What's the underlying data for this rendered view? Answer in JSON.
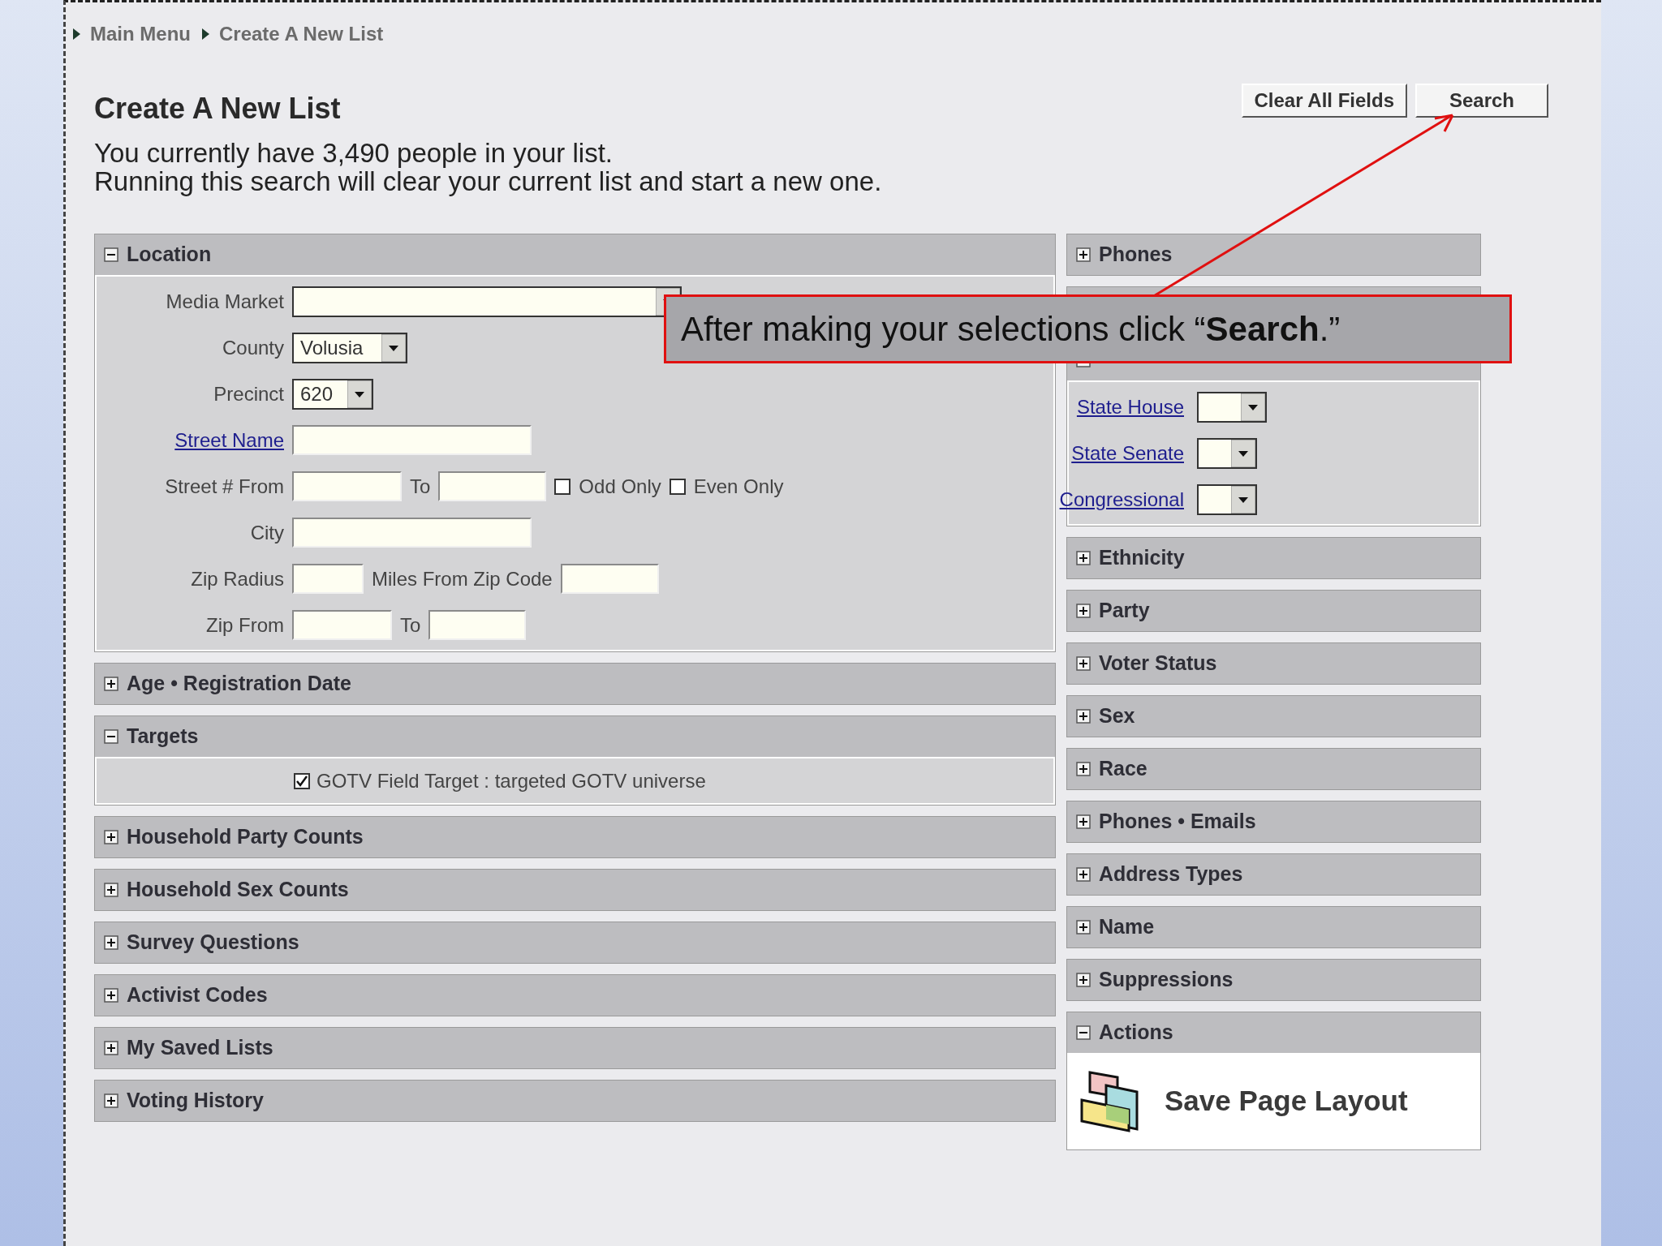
{
  "breadcrumb": [
    "Main Menu",
    "Create A New List"
  ],
  "title": "Create A New List",
  "intro": [
    "You currently have 3,490 people in your list.",
    "Running this search will clear your current list and start a new one."
  ],
  "buttons": [
    "Clear All Fields",
    "Search"
  ],
  "left_panels": [
    {
      "kind": "panel",
      "title": "Location",
      "expanded": true,
      "body": {
        "kind": "location",
        "media_market": {
          "label": "Media Market"
        },
        "county": {
          "label": "County",
          "value": "Volusia"
        },
        "precinct": {
          "label": "Precinct",
          "value": "620"
        },
        "street_name": {
          "label": "Street Name"
        },
        "street_from": {
          "label": "Street # From",
          "to_label": "To",
          "odd": {
            "label": "Odd Only",
            "checked": false
          },
          "even": {
            "label": "Even Only",
            "checked": false
          }
        },
        "city": {
          "label": "City"
        },
        "zip_radius": {
          "label": "Zip Radius",
          "miles_label": "Miles From Zip Code"
        },
        "zip_from": {
          "label": "Zip From",
          "to_label": "To"
        }
      }
    },
    {
      "kind": "panel",
      "title": "Age • Registration Date",
      "expanded": false
    },
    {
      "kind": "panel",
      "title": "Targets",
      "expanded": true,
      "body": {
        "kind": "targets",
        "items": [
          {
            "label": "GOTV Field Target : targeted GOTV universe",
            "checked": true
          }
        ]
      }
    },
    {
      "kind": "panel",
      "title": "Household Party Counts",
      "expanded": false
    },
    {
      "kind": "panel",
      "title": "Household Sex Counts",
      "expanded": false
    },
    {
      "kind": "panel",
      "title": "Survey Questions",
      "expanded": false
    },
    {
      "kind": "panel",
      "title": "Activist Codes",
      "expanded": false
    },
    {
      "kind": "panel",
      "title": "My Saved Lists",
      "expanded": false
    },
    {
      "kind": "panel",
      "title": "Voting History",
      "expanded": false
    }
  ],
  "right_panels": [
    {
      "kind": "panel",
      "title": "Phones",
      "expanded": false
    },
    {
      "kind": "covered"
    },
    {
      "kind": "panel",
      "expanded": true,
      "body": {
        "kind": "districts",
        "items": [
          {
            "label": "State House"
          },
          {
            "label": "State Senate"
          },
          {
            "label": "Congressional"
          }
        ]
      }
    },
    {
      "kind": "panel",
      "title": "Ethnicity",
      "expanded": false
    },
    {
      "kind": "panel",
      "title": "Party",
      "expanded": false
    },
    {
      "kind": "panel",
      "title": "Voter Status",
      "expanded": false
    },
    {
      "kind": "panel",
      "title": "Sex",
      "expanded": false
    },
    {
      "kind": "panel",
      "title": "Race",
      "expanded": false
    },
    {
      "kind": "panel",
      "title": "Phones • Emails",
      "expanded": false
    },
    {
      "kind": "panel",
      "title": "Address Types",
      "expanded": false
    },
    {
      "kind": "panel",
      "title": "Name",
      "expanded": false
    },
    {
      "kind": "panel",
      "title": "Suppressions",
      "expanded": false
    },
    {
      "kind": "panel",
      "title": "Actions",
      "expanded": true,
      "body": {
        "kind": "actions",
        "label": "Save Page Layout"
      }
    }
  ],
  "callout": {
    "text": "After making your selections click “**Search**.”"
  }
}
